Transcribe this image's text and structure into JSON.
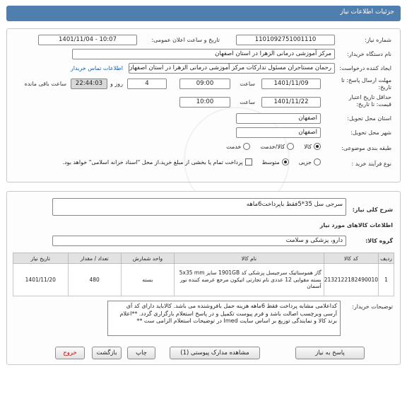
{
  "header": {
    "title": "جزئیات اطلاعات نیاز"
  },
  "info": {
    "need_number_label": "شماره نیاز:",
    "need_number": "1101092751001110",
    "announce_label": "تاریخ و ساعت اعلان عمومی:",
    "announce_value": "1401/11/04 - 10:07",
    "buyer_org_label": "نام دستگاه خریدار:",
    "buyer_org": "مرکز آموزشی درمانی الزهرا در استان اصفهان",
    "creator_label": "ایجاد کننده درخواست:",
    "creator": "رحمان مستاجران مسئول تدارکات مرکز آموزشی درمانی الزهرا در استان اصفهان",
    "contact_link": "اطلاعات تماس خریدار",
    "deadline_label": "مهلت ارسال پاسخ: تا تاریخ:",
    "deadline_date": "1401/11/09",
    "time_label": "ساعت",
    "deadline_time": "09:00",
    "days_value": "4",
    "days_label": "روز و",
    "remaining_time": "22:44:03",
    "remaining_label": "ساعت باقی مانده",
    "validity_label": "حداقل تاریخ اعتبار قیمت: تا تاریخ:",
    "validity_date": "1401/11/22",
    "validity_time": "10:00",
    "province_label": "استان محل تحویل:",
    "province": "اصفهان",
    "city_label": "شهر محل تحویل:",
    "city": "اصفهان",
    "category_label": "طبقه بندی موضوعی:",
    "category_options": [
      "کالا",
      "کالا/خدمت",
      "خدمت"
    ],
    "process_label": "نوع فرآیند خرید :",
    "process_options": [
      "جزیی",
      "متوسط"
    ],
    "treasury_note": "پرداخت تمام یا بخشی از مبلغ خرید،از محل \"اسناد خزانه اسلامی\" خواهد بود."
  },
  "summary": {
    "label": "شرح کلی نیاز:",
    "value": "سرجی سل 35*5فقط باپرداخت6ماهه"
  },
  "goods": {
    "section_title": "اطلاعات کالاهای مورد نیاز",
    "group_label": "گروه کالا:",
    "group_value": "دارو، پزشکی و سلامت",
    "columns": [
      "ردیف",
      "کد کالا",
      "نام کالا",
      "واحد شمارش",
      "تعداد / مقدار",
      "تاریخ نیاز"
    ],
    "rows": [
      {
        "row": "1",
        "code": "2132122182490010",
        "name": "گاز هموستاتیک سرجیسل پزشکی کد 1901GB سایز 5x35 mm بسته مقوایی 12 عددی نام تجارتی اتیکون مرجع عرضه کننده نور آسمان",
        "unit": "بسته",
        "qty": "480",
        "date": "1401/11/20"
      }
    ],
    "notes_label": "توضیحات خریدار:",
    "notes": "کداعلامی مشابه پرداخت فقط 6ماهه هزینه حمل بافروشنده می باشد. کالاباید دارای کد آی آرسی وبرچسب اصالت باشد و فرم پیوست تکمیل و در پاسخ استعلام بارگزاری گردد. **اعلام برند کالا و نمایندگی توزیع بر اساس سایت Imed در توضیحات استعلام الزامی ست **"
  },
  "buttons": {
    "reply": "پاسخ به نیاز",
    "attachments": "مشاهده مدارک پیوستی (1)",
    "print": "چاپ",
    "back": "بازگشت",
    "exit": "خروج"
  }
}
